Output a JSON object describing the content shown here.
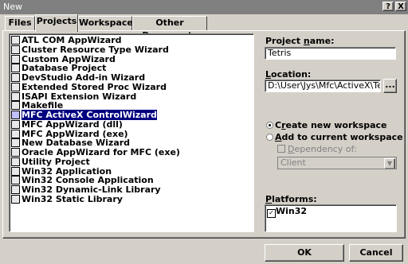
{
  "window": {
    "title": "New",
    "help_btn": "?",
    "close_btn": "X"
  },
  "tabs": [
    {
      "label": "Files"
    },
    {
      "label": "Projects"
    },
    {
      "label": "Workspaces"
    },
    {
      "label": "Other Documents"
    }
  ],
  "projects": [
    {
      "label": "ATL COM AppWizard",
      "icon": "atl-icon"
    },
    {
      "label": "Cluster Resource Type Wizard",
      "icon": "wizard-icon"
    },
    {
      "label": "Custom AppWizard",
      "icon": "wizard-icon"
    },
    {
      "label": "Database Project",
      "icon": "database-icon"
    },
    {
      "label": "DevStudio Add-in Wizard",
      "icon": "addin-icon"
    },
    {
      "label": "Extended Stored Proc Wizard",
      "icon": "wizard-icon"
    },
    {
      "label": "ISAPI Extension Wizard",
      "icon": "globe-icon"
    },
    {
      "label": "Makefile",
      "icon": "makefile-icon"
    },
    {
      "label": "MFC ActiveX ControlWizard",
      "icon": "activex-icon",
      "selected": true
    },
    {
      "label": "MFC AppWizard (dll)",
      "icon": "mfc-icon"
    },
    {
      "label": "MFC AppWizard (exe)",
      "icon": "mfc-icon"
    },
    {
      "label": "New Database Wizard",
      "icon": "wand-icon"
    },
    {
      "label": "Oracle AppWizard for MFC (exe)",
      "icon": "wizard-icon"
    },
    {
      "label": "Utility Project",
      "icon": "utility-icon"
    },
    {
      "label": "Win32 Application",
      "icon": "window-icon"
    },
    {
      "label": "Win32 Console Application",
      "icon": "console-icon"
    },
    {
      "label": "Win32 Dynamic-Link Library",
      "icon": "dll-icon"
    },
    {
      "label": "Win32 Static Library",
      "icon": "lib-icon"
    }
  ],
  "project_name": {
    "label_pre": "Project ",
    "label_u": "n",
    "label_post": "ame:",
    "value": "Tetris"
  },
  "location": {
    "label_u": "L",
    "label_post": "ocation:",
    "value": "D:\\User\\Jys\\Mfc\\ActiveX\\Tet",
    "browse": "..."
  },
  "workspace": {
    "create_u": "r",
    "create_pre": "C",
    "create_post": "eate new workspace",
    "add_u": "A",
    "add_post": "dd to current workspace",
    "dependency_u": "D",
    "dependency_post": "ependency of:",
    "dependency_value": "Client",
    "selected": "create"
  },
  "platforms": {
    "label_u": "P",
    "label_post": "latforms:",
    "items": [
      {
        "label": "Win32",
        "checked": true
      }
    ]
  },
  "buttons": {
    "ok": "OK",
    "cancel": "Cancel"
  }
}
